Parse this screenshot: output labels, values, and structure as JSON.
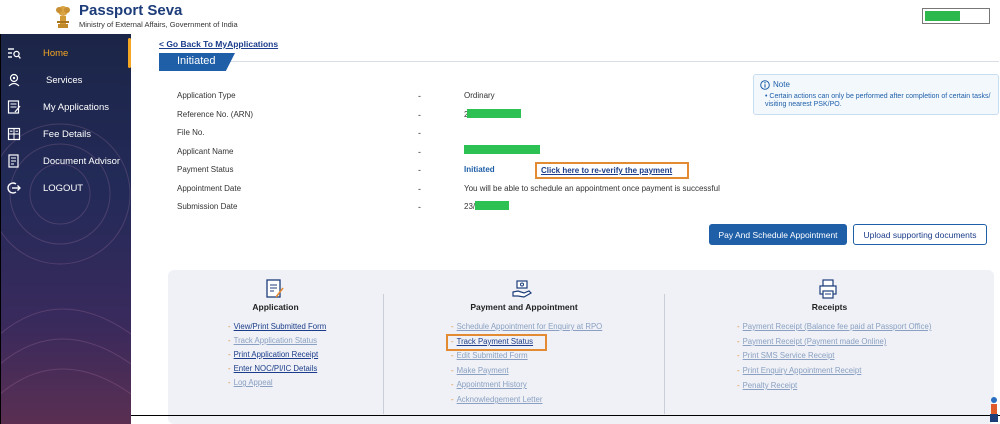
{
  "header": {
    "brand_title": "Passport Seva",
    "brand_subtitle": "Ministry of External Affairs, Government of India"
  },
  "sidebar": {
    "items": [
      {
        "label": "Home",
        "icon": "home-search-icon",
        "active": true
      },
      {
        "label": "Services",
        "icon": "services-icon",
        "active": false
      },
      {
        "label": "My Applications",
        "icon": "applications-icon",
        "active": false
      },
      {
        "label": "Fee Details",
        "icon": "fee-calculator-icon",
        "active": false
      },
      {
        "label": "Document Advisor",
        "icon": "document-advisor-icon",
        "active": false
      },
      {
        "label": "LOGOUT",
        "icon": "logout-icon",
        "active": false
      }
    ]
  },
  "main": {
    "back_link": "< Go Back To MyApplications",
    "status_tab": "Initiated",
    "fields": [
      {
        "label": "Application Type",
        "value": "Ordinary"
      },
      {
        "label": "Reference No. (ARN)",
        "value": "2"
      },
      {
        "label": "File No.",
        "value": ""
      },
      {
        "label": "Applicant Name",
        "value": ""
      },
      {
        "label": "Payment Status",
        "value": "Initiated"
      },
      {
        "label": "Appointment Date",
        "value": "You will be able to schedule an appointment once payment is successful"
      },
      {
        "label": "Submission Date",
        "value": "23/"
      }
    ],
    "separator": "-",
    "reverify_link": "Click here to re-verify the payment",
    "note": {
      "title": "Note",
      "text": "Certain actions can only be performed after completion of certain tasks/ visiting nearest PSK/PO."
    },
    "buttons": {
      "pay_schedule": "Pay And Schedule Appointment",
      "upload_docs": "Upload supporting documents"
    }
  },
  "panel": {
    "application": {
      "title": "Application",
      "links": [
        {
          "label": "View/Print Submitted Form",
          "enabled": true
        },
        {
          "label": "Track Application Status",
          "enabled": false
        },
        {
          "label": "Print Application Receipt",
          "enabled": true
        },
        {
          "label": "Enter NOC/PI/IC Details",
          "enabled": true
        },
        {
          "label": "Log Appeal",
          "enabled": false
        }
      ]
    },
    "payment": {
      "title": "Payment and Appointment",
      "links": [
        {
          "label": "Schedule Appointment for Enquiry at RPO",
          "enabled": false
        },
        {
          "label": "Track Payment Status",
          "enabled": true
        },
        {
          "label": "Edit Submitted Form",
          "enabled": false
        },
        {
          "label": "Make Payment",
          "enabled": false
        },
        {
          "label": "Appointment History",
          "enabled": false
        },
        {
          "label": "Acknowledgement Letter",
          "enabled": false
        }
      ]
    },
    "receipts": {
      "title": "Receipts",
      "links": [
        {
          "label": "Payment Receipt (Balance fee paid at Passport Office)",
          "enabled": false
        },
        {
          "label": "Payment Receipt (Payment made Online)",
          "enabled": false
        },
        {
          "label": "Print SMS Service Receipt",
          "enabled": false
        },
        {
          "label": "Print Enquiry Appointment Receipt",
          "enabled": false
        },
        {
          "label": "Penalty Receipt",
          "enabled": false
        }
      ]
    }
  },
  "colors": {
    "accent_blue": "#1e5fa8",
    "highlight_orange": "#e38b33",
    "redaction_green": "#2cc152",
    "active_nav": "#f5a623"
  }
}
